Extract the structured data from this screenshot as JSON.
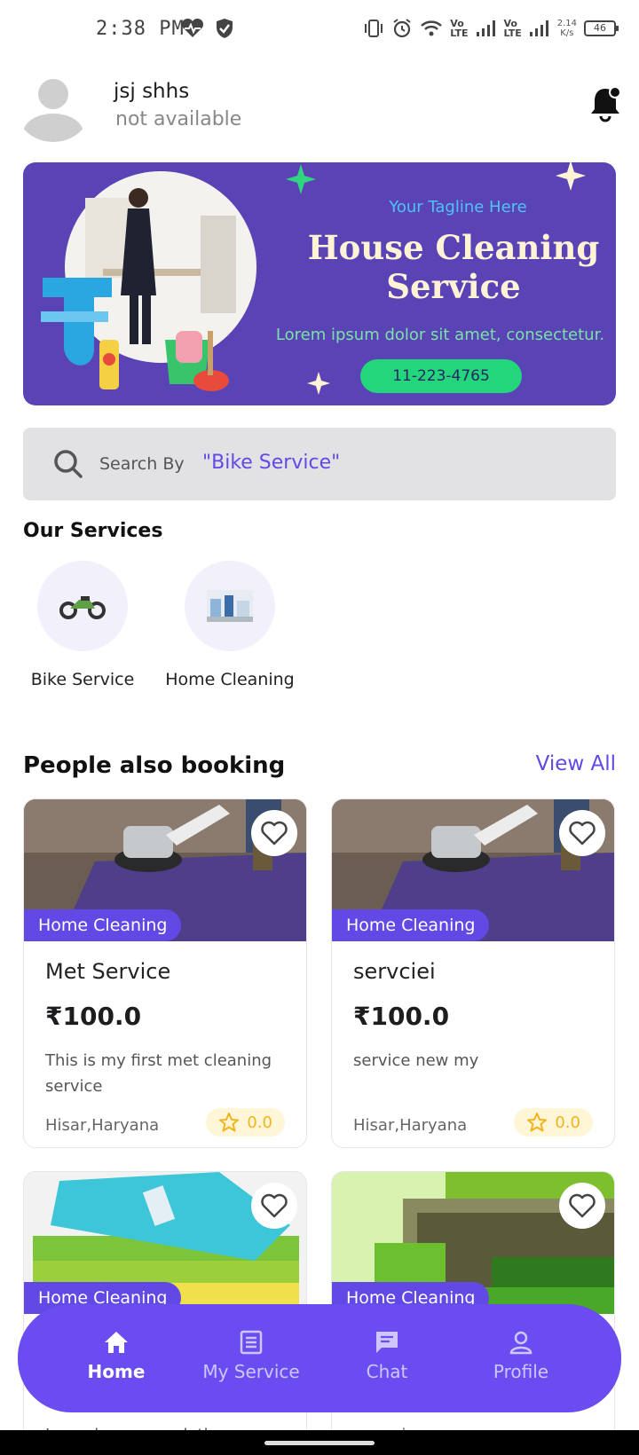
{
  "status_bar": {
    "time": "2:38 PM",
    "vo_lte_1": "Vo\nLTE",
    "vo_lte_2": "Vo\nLTE",
    "speed": "2.14\nK/s",
    "battery": "46"
  },
  "header": {
    "user_name": "jsj shhs",
    "user_status": "not available"
  },
  "banner": {
    "tagline": "Your Tagline Here",
    "title": "House Cleaning Service",
    "subtitle": "Lorem ipsum dolor sit amet, consectetur.",
    "phone": "11-223-4765",
    "colors": {
      "background": "#5a43b5",
      "title": "#fff3d6",
      "phone_bg": "#23d57b"
    }
  },
  "search": {
    "label": "Search By",
    "hint": "\"Bike Service\""
  },
  "services": {
    "title": "Our Services",
    "items": [
      {
        "label": "Bike Service",
        "icon": "motorbike-icon"
      },
      {
        "label": "Home Cleaning",
        "icon": "home-cleaning-thumb"
      }
    ]
  },
  "booking": {
    "title": "People also booking",
    "view_all": "View All",
    "cards": [
      {
        "tag": "Home Cleaning",
        "name": "Met Service",
        "price": "₹100.0",
        "description": "This is my first met cleaning service",
        "location": "Hisar,Haryana",
        "rating": "0.0"
      },
      {
        "tag": "Home Cleaning",
        "name": "servciei",
        "price": "₹100.0",
        "description": "service new my",
        "location": "Hisar,Haryana",
        "rating": "0.0"
      },
      {
        "tag": "Home Cleaning",
        "description": "I am clean your cloths"
      },
      {
        "tag": "Home Cleaning",
        "description": "new gien"
      }
    ]
  },
  "bottom_nav": {
    "items": [
      {
        "label": "Home",
        "icon": "home-icon",
        "active": true
      },
      {
        "label": "My Service",
        "icon": "list-icon",
        "active": false
      },
      {
        "label": "Chat",
        "icon": "chat-icon",
        "active": false
      },
      {
        "label": "Profile",
        "icon": "profile-icon",
        "active": false
      }
    ],
    "colors": {
      "background": "#6a4cf0"
    }
  },
  "accent_color": "#6249e6"
}
